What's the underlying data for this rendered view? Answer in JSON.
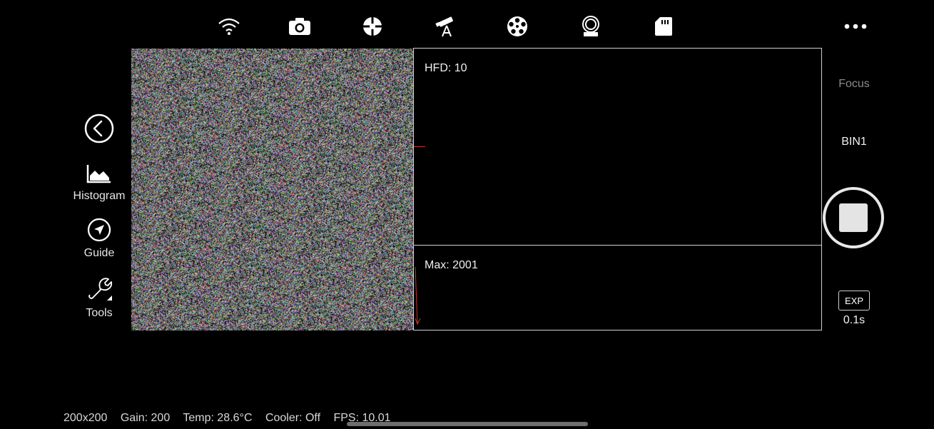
{
  "toolbar": {
    "icons": [
      "wifi-icon",
      "camera-icon",
      "crosshair-icon",
      "telescope-icon",
      "filter-wheel-icon",
      "focuser-icon",
      "sd-card-icon",
      "more-icon"
    ]
  },
  "sidebar": {
    "histogram_label": "Histogram",
    "guide_label": "Guide",
    "tools_label": "Tools"
  },
  "hfd_panel": {
    "text": "HFD: 10"
  },
  "max_panel": {
    "text": "Max: 2001"
  },
  "right": {
    "mode_label": "Focus",
    "bin_label": "BIN1",
    "exp_badge": "EXP",
    "exp_value": "0.1s"
  },
  "status_bar": {
    "resolution": "200x200",
    "gain": "Gain: 200",
    "temp": "Temp: 28.6°C",
    "cooler": "Cooler: Off",
    "fps": "FPS: 10.01"
  },
  "colors": {
    "accent_red": "#c0392b",
    "panel_border": "#d0d0d0"
  }
}
